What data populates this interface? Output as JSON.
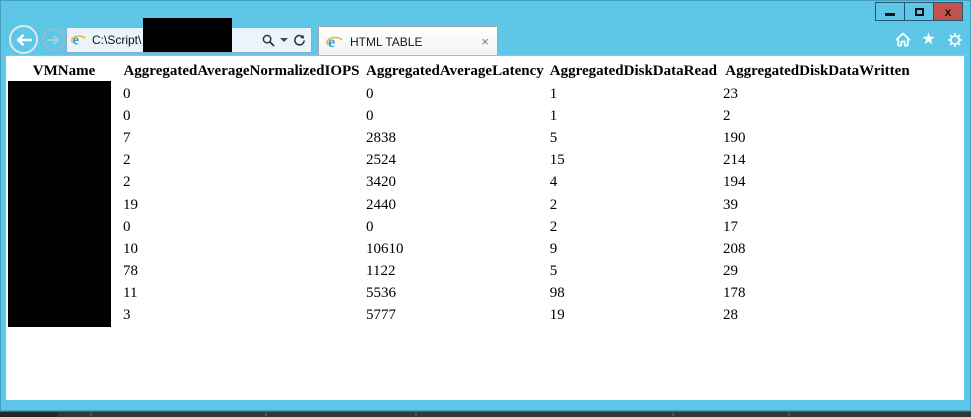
{
  "window": {
    "minimize_glyph": "",
    "maximize_glyph": "",
    "close_glyph": "x",
    "titlebar_color": "#5ec7e8",
    "close_button_color": "#c4524d"
  },
  "browser": {
    "address_text": "C:\\Script\\",
    "tab_title": "HTML TABLE",
    "tab_close_glyph": "×",
    "star_glyph": "★",
    "icons": {
      "back": "back-arrow-icon",
      "forward": "forward-arrow-icon",
      "address_logo": "ie-logo-icon",
      "search": "magnifier-icon",
      "search_dropdown": "chevron-down-icon",
      "refresh": "refresh-icon",
      "tab_logo": "ie-logo-icon",
      "home": "home-icon",
      "favorites": "star-icon",
      "settings": "gear-icon"
    }
  },
  "table": {
    "columns": [
      "VMName",
      "AggregatedAverageNormalizedIOPS",
      "AggregatedAverageLatency",
      "AggregatedDiskDataRead",
      "AggregatedDiskDataWritten"
    ],
    "vmname_column_redacted": true,
    "rows": [
      [
        "",
        "0",
        "0",
        "1",
        "23"
      ],
      [
        "",
        "0",
        "0",
        "1",
        "2"
      ],
      [
        "",
        "7",
        "2838",
        "5",
        "190"
      ],
      [
        "",
        "2",
        "2524",
        "15",
        "214"
      ],
      [
        "",
        "2",
        "3420",
        "4",
        "194"
      ],
      [
        "",
        "19",
        "2440",
        "2",
        "39"
      ],
      [
        "",
        "0",
        "0",
        "2",
        "17"
      ],
      [
        "",
        "10",
        "10610",
        "9",
        "208"
      ],
      [
        "",
        "78",
        "1122",
        "5",
        "29"
      ],
      [
        "",
        "11",
        "5536",
        "98",
        "178"
      ],
      [
        "",
        "3",
        "5777",
        "19",
        "28"
      ]
    ]
  }
}
